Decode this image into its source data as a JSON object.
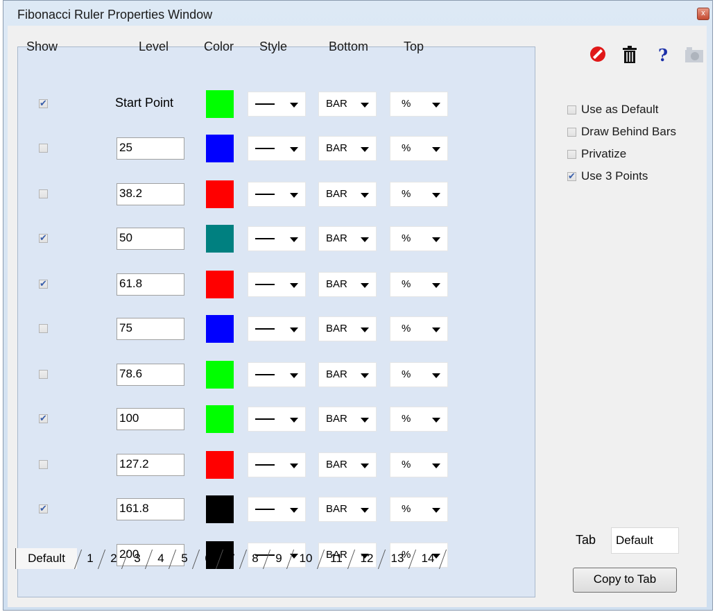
{
  "window": {
    "title": "Fibonacci Ruler Properties Window",
    "close_label": "x"
  },
  "headers": {
    "show": "Show",
    "level": "Level",
    "color": "Color",
    "style": "Style",
    "bottom": "Bottom",
    "top": "Top"
  },
  "rows": [
    {
      "show": true,
      "level": "Start Point",
      "editable": false,
      "color": "#00ff00",
      "style": "solid-line",
      "bottom": "BAR",
      "top": "%"
    },
    {
      "show": false,
      "level": "25",
      "editable": true,
      "color": "#0000ff",
      "style": "solid-line",
      "bottom": "BAR",
      "top": "%"
    },
    {
      "show": false,
      "level": "38.2",
      "editable": true,
      "color": "#ff0000",
      "style": "solid-line",
      "bottom": "BAR",
      "top": "%"
    },
    {
      "show": true,
      "level": "50",
      "editable": true,
      "color": "#008080",
      "style": "solid-line",
      "bottom": "BAR",
      "top": "%"
    },
    {
      "show": true,
      "level": "61.8",
      "editable": true,
      "color": "#ff0000",
      "style": "solid-line",
      "bottom": "BAR",
      "top": "%"
    },
    {
      "show": false,
      "level": "75",
      "editable": true,
      "color": "#0000ff",
      "style": "solid-line",
      "bottom": "BAR",
      "top": "%"
    },
    {
      "show": false,
      "level": "78.6",
      "editable": true,
      "color": "#00ff00",
      "style": "solid-line",
      "bottom": "BAR",
      "top": "%"
    },
    {
      "show": true,
      "level": "100",
      "editable": true,
      "color": "#00ff00",
      "style": "solid-line",
      "bottom": "BAR",
      "top": "%"
    },
    {
      "show": false,
      "level": "127.2",
      "editable": true,
      "color": "#ff0000",
      "style": "solid-line",
      "bottom": "BAR",
      "top": "%"
    },
    {
      "show": true,
      "level": "161.8",
      "editable": true,
      "color": "#000000",
      "style": "solid-line",
      "bottom": "BAR",
      "top": "%"
    },
    {
      "show": false,
      "level": "200",
      "editable": true,
      "color": "#000000",
      "style": "solid-line",
      "bottom": "BAR",
      "top": "%"
    }
  ],
  "tabs": [
    "Default",
    "1",
    "2",
    "3",
    "4",
    "5",
    "6",
    "7",
    "8",
    "9",
    "10",
    "11",
    "12",
    "13",
    "14"
  ],
  "active_tab": "Default",
  "toolbar_icons": [
    "cancel-icon",
    "trash-icon",
    "help-icon",
    "camera-icon"
  ],
  "options": [
    {
      "label": "Use as Default",
      "checked": false
    },
    {
      "label": "Draw Behind Bars",
      "checked": false
    },
    {
      "label": "Privatize",
      "checked": false
    },
    {
      "label": "Use 3 Points",
      "checked": true
    }
  ],
  "tab_field": {
    "label": "Tab",
    "value": "Default"
  },
  "copy_button": "Copy to Tab"
}
